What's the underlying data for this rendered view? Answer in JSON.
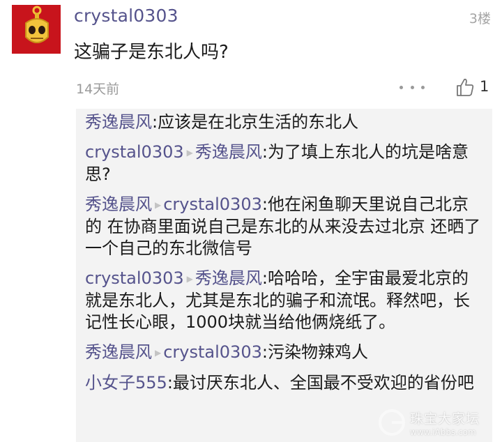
{
  "post": {
    "username": "crystal0303",
    "floor": "3楼",
    "content": "这骗子是东北人吗?",
    "time": "14天前",
    "like_count": "1"
  },
  "replies": [
    {
      "author": "秀逸晨风",
      "target": "",
      "text": ":应该是在北京生活的东北人"
    },
    {
      "author": "crystal0303",
      "target": "秀逸晨风",
      "text": ":为了填上东北人的坑是啥意思?"
    },
    {
      "author": "秀逸晨风",
      "target": "crystal0303",
      "text": ":他在闲鱼聊天里说自己北京的 在协商里面说自己是东北的从来没去过北京 还晒了一个自己的东北微信号"
    },
    {
      "author": "crystal0303",
      "target": "秀逸晨风",
      "text": ":哈哈哈，全宇宙最爱北京的就是东北人，尤其是东北的骗子和流氓。释然吧，长记性长心眼，1000块就当给他俩烧纸了。"
    },
    {
      "author": "秀逸晨风",
      "target": "crystal0303",
      "text": ":污染物辣鸡人"
    },
    {
      "author": "小女子555",
      "target": "",
      "text": ":最讨厌东北人、全国最不受欢迎的省份吧"
    }
  ],
  "watermark": {
    "cn": "珠宝大家坛",
    "en": "www.iAbbs.com"
  },
  "colors": {
    "author": "#55538c",
    "background": "#f3f3f3",
    "avatar": "#c8141c"
  },
  "icons": {
    "more": "more-dots-icon",
    "like": "thumbs-up-icon",
    "arrow": "reply-arrow-icon"
  }
}
